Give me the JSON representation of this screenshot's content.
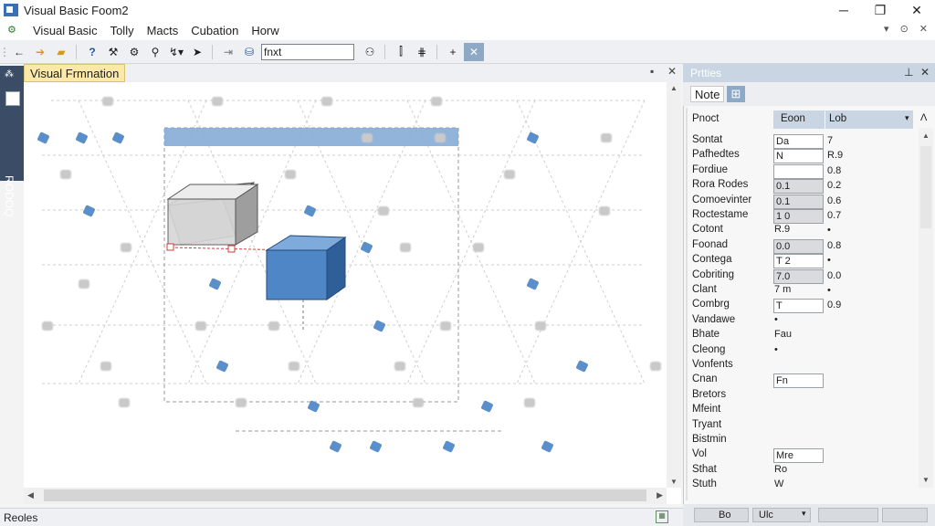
{
  "window": {
    "title": "Visual Basic  Foom2",
    "minimize_glyph": "─",
    "maximize_glyph": "❐",
    "close_glyph": "✕"
  },
  "menu": {
    "items": [
      "Visual Basic",
      "Tolly",
      "Macts",
      "Cubation",
      "Horw"
    ],
    "right_controls": [
      "▾",
      "⊙",
      "✕"
    ]
  },
  "toolbar": {
    "search_value": "fnxt"
  },
  "sidebar": {
    "label": "RODOQ"
  },
  "document": {
    "tab_label": "Visual Frmnation",
    "pin_glyph": "▪",
    "close_glyph": "✕"
  },
  "properties": {
    "title": "Prtties",
    "tabs": [
      "Note",
      "⊞"
    ],
    "header": {
      "name": "Pnoct",
      "col1": "Eoon",
      "col2": "Lob"
    },
    "rows": [
      {
        "name": "Sontat",
        "box": "Da",
        "value": "7"
      },
      {
        "name": "Pafhedtes",
        "box": "N",
        "value": "R.9"
      },
      {
        "name": "Fordiue",
        "box": "",
        "value": "0.8"
      },
      {
        "name": "Rora Rodes",
        "box": "0.1",
        "value": "0.2"
      },
      {
        "name": "Comoevinter",
        "box": "0.1",
        "value": "0.6"
      },
      {
        "name": "Roctestame",
        "box": "1 0",
        "value": "0.7"
      },
      {
        "name": "Cotont",
        "plain": "R.9",
        "value": "•"
      },
      {
        "name": "Foonad",
        "box": "0.0",
        "value": "0.8"
      },
      {
        "name": "Contega",
        "box": "T 2",
        "value": "•"
      },
      {
        "name": "Cobriting",
        "box": "7.0",
        "value": "0.0"
      },
      {
        "name": "Clant",
        "plain": "7 m",
        "value": "•"
      },
      {
        "name": "Combrg",
        "box": "T",
        "value": "0.9"
      },
      {
        "name": "Vandawe",
        "plain": "•",
        "value": ""
      },
      {
        "name": "Bhate",
        "plain": "Fau",
        "value": ""
      },
      {
        "name": "Cleong",
        "plain": "•",
        "value": ""
      },
      {
        "name": "Vonfents",
        "plain": "",
        "value": ""
      },
      {
        "name": "Cnan",
        "box": "Fn",
        "value": ""
      },
      {
        "name": "Bretors",
        "plain": "",
        "value": ""
      },
      {
        "name": "Mfeint",
        "plain": "",
        "value": ""
      },
      {
        "name": "Tryant",
        "plain": "",
        "value": ""
      },
      {
        "name": "Bistmin",
        "plain": "",
        "value": ""
      },
      {
        "name": "Vol",
        "box": "Mre",
        "value": ""
      },
      {
        "name": "Sthat",
        "plain": "Ro",
        "value": ""
      },
      {
        "name": "Stuth",
        "plain": "W",
        "value": ""
      }
    ],
    "bottom_fields": [
      "Bo",
      "Ulc"
    ]
  },
  "status": {
    "text": "Reoles"
  },
  "colors": {
    "accent": "#5b8fcb",
    "selection_band": "#7fa7d4",
    "handle_red": "#d33b3b"
  }
}
